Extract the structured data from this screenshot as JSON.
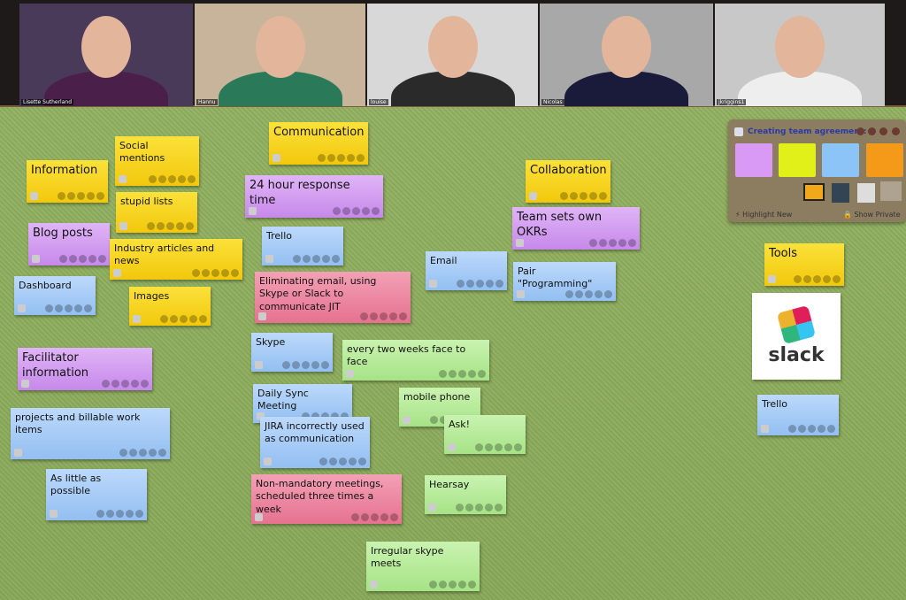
{
  "participants": [
    {
      "name": "Lisette Sutherland",
      "bg": "#4a3a5a",
      "shirt": "#4a1f4a"
    },
    {
      "name": "Hannu",
      "bg": "#c8b49a",
      "shirt": "#2a7a5a"
    },
    {
      "name": "louise",
      "bg": "#d8d8d8",
      "shirt": "#2a2a2a"
    },
    {
      "name": "Nicolas",
      "bg": "#a8a8a8",
      "shirt": "#1a1a3a"
    },
    {
      "name": "jkriggins1",
      "bg": "#c8c8c8",
      "shirt": "#eeeeee"
    }
  ],
  "notes": [
    {
      "text": "Social mentions",
      "color": "yellow"
    },
    {
      "text": "Information",
      "color": "yellow"
    },
    {
      "text": "Communication",
      "color": "yellow"
    },
    {
      "text": "stupid lists",
      "color": "yellow"
    },
    {
      "text": "24 hour response time",
      "color": "purple"
    },
    {
      "text": "Blog posts",
      "color": "purple"
    },
    {
      "text": "Industry articles and news",
      "color": "yellow"
    },
    {
      "text": "Trello",
      "color": "blue"
    },
    {
      "text": "Dashboard",
      "color": "blue"
    },
    {
      "text": "Images",
      "color": "yellow"
    },
    {
      "text": "Eliminating email, using Skype or Slack to communicate JIT",
      "color": "pink"
    },
    {
      "text": "Email",
      "color": "blue"
    },
    {
      "text": "Collaboration",
      "color": "yellow"
    },
    {
      "text": "Team sets own OKRs",
      "color": "purple"
    },
    {
      "text": "Pair \"Programming\"",
      "color": "blue"
    },
    {
      "text": "Facilitator information",
      "color": "purple"
    },
    {
      "text": "Skype",
      "color": "blue"
    },
    {
      "text": "every two weeks face to face",
      "color": "green"
    },
    {
      "text": "projects and billable work items",
      "color": "blue"
    },
    {
      "text": "Daily Sync Meeting",
      "color": "blue"
    },
    {
      "text": "mobile phone",
      "color": "green"
    },
    {
      "text": "JIRA incorrectly used as communication",
      "color": "blue"
    },
    {
      "text": "Ask!",
      "color": "green"
    },
    {
      "text": "As little as possible",
      "color": "blue"
    },
    {
      "text": "Non-mandatory meetings, scheduled three times a week",
      "color": "pink"
    },
    {
      "text": "Hearsay",
      "color": "green"
    },
    {
      "text": "Irregular skype meets",
      "color": "green"
    },
    {
      "text": "Tools",
      "color": "yellow"
    },
    {
      "text": "Trello",
      "color": "blue"
    }
  ],
  "slack_image": {
    "word": "slack"
  },
  "panel": {
    "title": "Creating team agreement:",
    "highlight_new": "Highlight New",
    "show_private": "Show Private",
    "pad_colors": [
      "#d99af5",
      "#e2f01a",
      "#8cc4f7",
      "#f59a18"
    ]
  }
}
